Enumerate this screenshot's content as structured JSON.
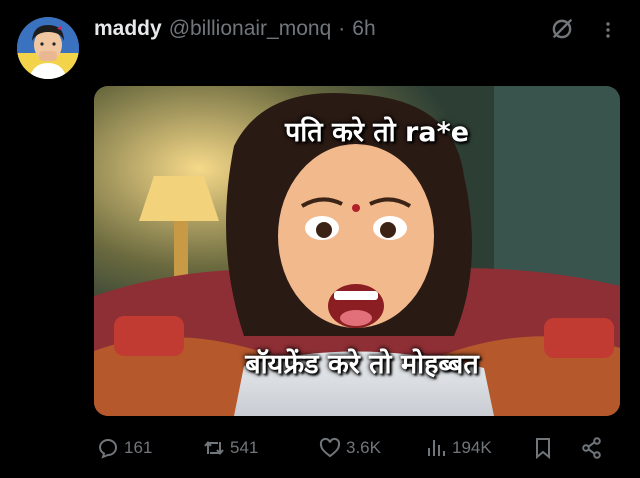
{
  "post": {
    "display_name": "maddy",
    "handle": "@billionair_monq",
    "separator": "·",
    "time": "6h"
  },
  "media": {
    "caption_top": "पति करे तो ra*e",
    "caption_bottom": "बॉयफ्रेंड करे तो मोहब्बत"
  },
  "actions": {
    "replies": "161",
    "reposts": "541",
    "likes": "3.6K",
    "views": "194K"
  },
  "colors": {
    "background": "#000000",
    "primary_text": "#e7e9ea",
    "secondary_text": "#71767b"
  },
  "icons": [
    "avatar",
    "grok-icon",
    "more-icon",
    "reply-icon",
    "repost-icon",
    "like-icon",
    "views-icon",
    "bookmark-icon",
    "share-icon"
  ]
}
